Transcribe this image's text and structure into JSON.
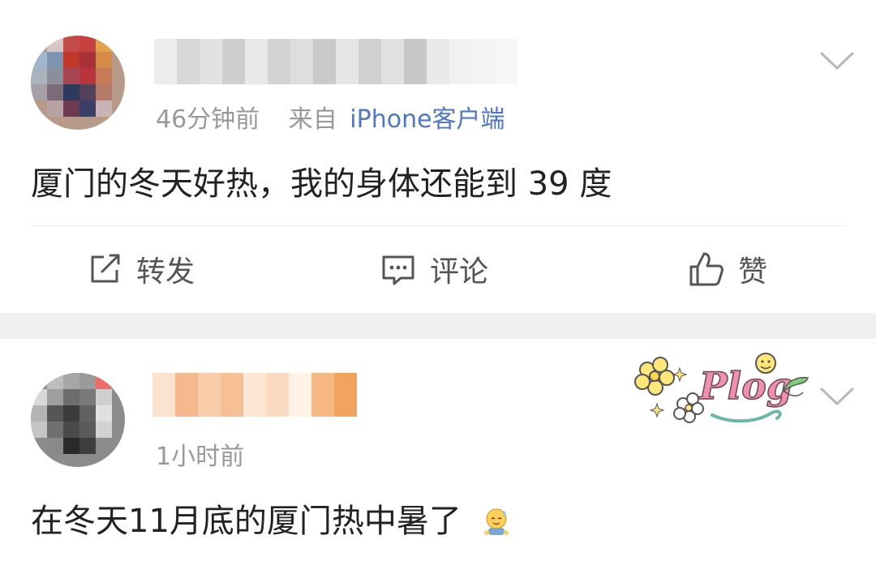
{
  "posts": [
    {
      "time": "46分钟前",
      "source_prefix": "来自",
      "source": "iPhone客户端",
      "text": "厦门的冬天好热，我的身体还能到 39 度",
      "actions": {
        "repost": "转发",
        "comment": "评论",
        "like": "赞"
      },
      "icons": [
        "repost-icon",
        "comment-icon",
        "like-icon",
        "chevron-down-icon"
      ]
    },
    {
      "time": "1小时前",
      "text": "在冬天11月底的厦门热中暑了",
      "emoji": "sweat-emoji",
      "badge": "Plog",
      "icons": [
        "chevron-down-icon"
      ]
    }
  ],
  "colors": {
    "source_link": "#4e77c9",
    "meta": "#999999",
    "text": "#222222",
    "separator": "#f0f0f0"
  }
}
